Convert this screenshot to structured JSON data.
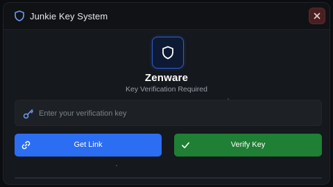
{
  "window": {
    "title": "Junkie Key System",
    "close_label": "Close"
  },
  "brand": {
    "name": "Zenware",
    "subtitle": "Key Verification Required"
  },
  "key_input": {
    "placeholder": "Enter your verification key",
    "value": ""
  },
  "buttons": {
    "get_link": "Get Link",
    "verify_key": "Verify Key"
  },
  "icons": {
    "title": "shield-icon",
    "logo": "shield-icon",
    "close": "close-icon",
    "key": "key-icon",
    "link": "link-icon",
    "verify": "check-icon"
  },
  "colors": {
    "accent_blue": "#2c6ef2",
    "accent_green": "#1f7f34",
    "close_red": "#4a1f22"
  }
}
